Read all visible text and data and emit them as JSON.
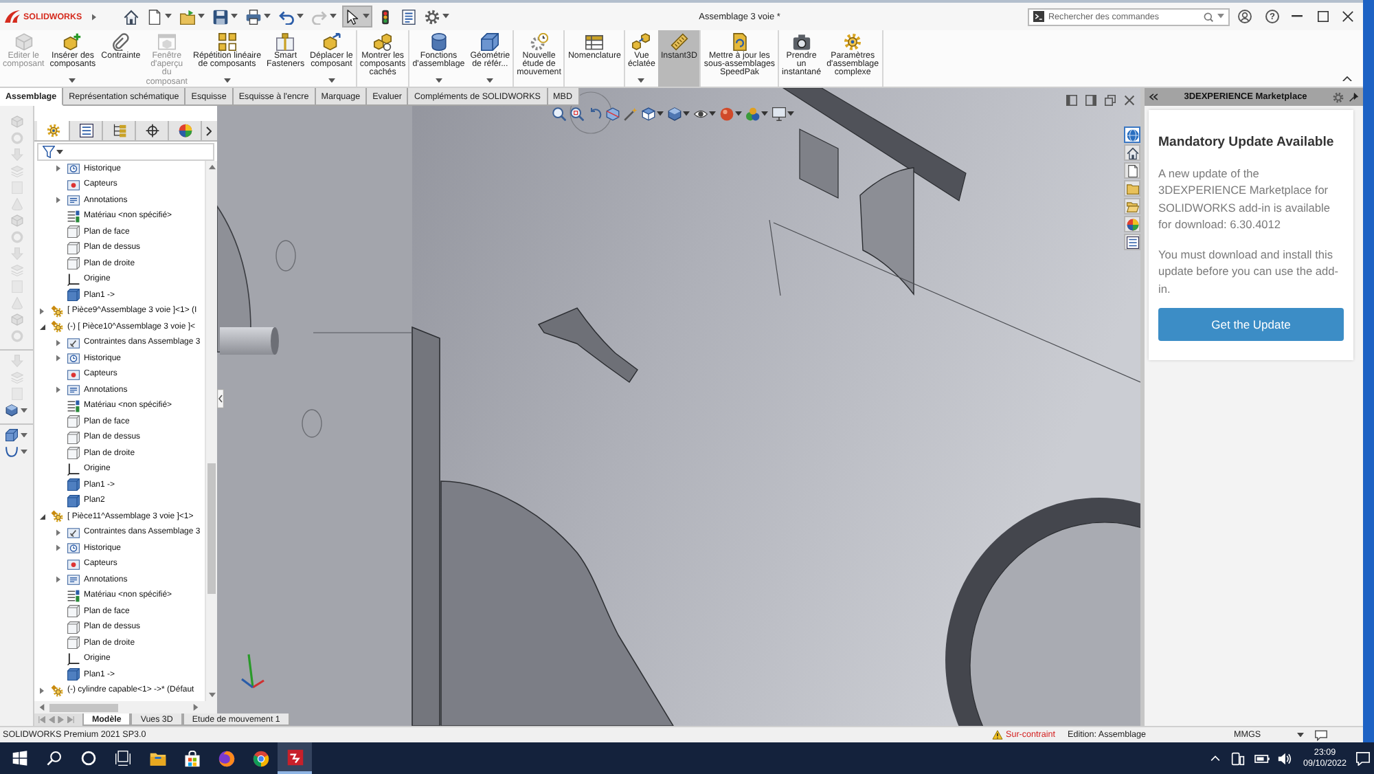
{
  "window": {
    "logo": "SOLIDWORKS",
    "title": "Assemblage 3 voie *",
    "search": {
      "placeholder": "Rechercher des commandes"
    },
    "help": "?"
  },
  "quick_access": [
    {
      "on": false,
      "disabled": false,
      "dropdown": false
    },
    {
      "on": false,
      "disabled": false,
      "dropdown": true
    },
    {
      "on": false,
      "disabled": false,
      "dropdown": true
    },
    {
      "on": false,
      "disabled": false,
      "dropdown": true
    },
    {
      "on": false,
      "disabled": false,
      "dropdown": true
    },
    {
      "on": false,
      "disabled": false,
      "dropdown": true
    },
    {
      "on": false,
      "disabled": true,
      "dropdown": true
    },
    {
      "on": true,
      "disabled": false,
      "dropdown": true
    },
    {
      "on": false,
      "disabled": false,
      "dropdown": false
    },
    {
      "on": false,
      "disabled": false,
      "dropdown": false
    },
    {
      "on": false,
      "disabled": false,
      "dropdown": true
    }
  ],
  "ribbon": {
    "groups": [
      {
        "buttons": [
          {
            "label": "Editer le\ncomposant",
            "disabled": true,
            "selected": false,
            "dropdown": false
          },
          {
            "label": "Insérer des\ncomposants",
            "disabled": false,
            "selected": false,
            "dropdown": true
          },
          {
            "label": "Contrainte",
            "disabled": false,
            "selected": false,
            "dropdown": false
          },
          {
            "label": "Fenêtre\nd'aperçu\ndu\ncomposant",
            "disabled": true,
            "selected": false,
            "dropdown": false
          },
          {
            "label": "Répétition linéaire\nde composants",
            "disabled": false,
            "selected": false,
            "dropdown": true
          },
          {
            "label": "Smart\nFasteners",
            "disabled": false,
            "selected": false,
            "dropdown": false
          },
          {
            "label": "Déplacer le\ncomposant",
            "disabled": false,
            "selected": false,
            "dropdown": true
          }
        ]
      },
      {
        "buttons": [
          {
            "label": "Montrer les\ncomposants\ncachés",
            "disabled": false,
            "selected": false,
            "dropdown": false
          }
        ]
      },
      {
        "buttons": [
          {
            "label": "Fonctions\nd'assemblage",
            "disabled": false,
            "selected": false,
            "dropdown": true
          },
          {
            "label": "Géométrie\nde référ...",
            "disabled": false,
            "selected": false,
            "dropdown": true
          }
        ]
      },
      {
        "buttons": [
          {
            "label": "Nouvelle\nétude de\nmouvement",
            "disabled": false,
            "selected": false,
            "dropdown": false
          }
        ]
      },
      {
        "buttons": [
          {
            "label": "Nomenclature",
            "disabled": false,
            "selected": false,
            "dropdown": false
          }
        ]
      },
      {
        "buttons": [
          {
            "label": "Vue\néclatée",
            "disabled": false,
            "selected": false,
            "dropdown": true
          },
          {
            "label": "Instant3D",
            "disabled": false,
            "selected": true,
            "dropdown": false
          }
        ]
      },
      {
        "buttons": [
          {
            "label": "Mettre à jour les\nsous-assemblages\nSpeedPak",
            "disabled": false,
            "selected": false,
            "dropdown": false
          }
        ]
      },
      {
        "buttons": [
          {
            "label": "Prendre\nun\ninstantané",
            "disabled": false,
            "selected": false,
            "dropdown": false
          },
          {
            "label": "Paramètres\nd'assemblage\ncomplexe",
            "disabled": false,
            "selected": false,
            "dropdown": false
          }
        ]
      }
    ]
  },
  "command_tabs": [
    {
      "label": "Assemblage",
      "selected": true
    },
    {
      "label": "Représentation schématique",
      "selected": false
    },
    {
      "label": "Esquisse",
      "selected": false
    },
    {
      "label": "Esquisse à l'encre",
      "selected": false
    },
    {
      "label": "Marquage",
      "selected": false
    },
    {
      "label": "Evaluer",
      "selected": false
    },
    {
      "label": "Compléments de SOLIDWORKS",
      "selected": false
    },
    {
      "label": "MBD",
      "selected": false
    }
  ],
  "left_toolbar": {
    "groups": [
      {
        "tools": [
          {
            "disabled": true,
            "dropdown": false
          },
          {
            "disabled": true,
            "dropdown": false
          },
          {
            "disabled": true,
            "dropdown": false
          },
          {
            "disabled": true,
            "dropdown": false
          },
          {
            "disabled": true,
            "dropdown": false
          },
          {
            "disabled": true,
            "dropdown": false
          },
          {
            "disabled": true,
            "dropdown": false
          },
          {
            "disabled": true,
            "dropdown": false
          },
          {
            "disabled": true,
            "dropdown": false
          },
          {
            "disabled": true,
            "dropdown": false
          },
          {
            "disabled": true,
            "dropdown": false
          },
          {
            "disabled": true,
            "dropdown": false
          },
          {
            "disabled": true,
            "dropdown": false
          },
          {
            "disabled": true,
            "dropdown": false
          }
        ]
      },
      {
        "tools": [
          {
            "disabled": true,
            "dropdown": false
          },
          {
            "disabled": true,
            "dropdown": false
          },
          {
            "disabled": true,
            "dropdown": false
          },
          {
            "disabled": false,
            "dropdown": true
          }
        ]
      },
      {
        "tools": [
          {
            "disabled": false,
            "dropdown": true
          },
          {
            "disabled": false,
            "dropdown": true
          }
        ]
      }
    ]
  },
  "feature_tree": {
    "panel_tabs": [
      {
        "selected": true
      },
      {
        "selected": false
      },
      {
        "selected": false
      },
      {
        "selected": false
      },
      {
        "selected": false
      }
    ],
    "items": [
      {
        "children": [
          {
            "label": "Historique",
            "kind": "history",
            "expanded": false
          },
          {
            "label": "Capteurs",
            "kind": "sensors"
          },
          {
            "label": "Annotations",
            "kind": "annotations",
            "expanded": false
          },
          {
            "label": "Matériau <non spécifié>",
            "kind": "material"
          },
          {
            "label": "Plan de face",
            "kind": "plane"
          },
          {
            "label": "Plan de dessus",
            "kind": "plane"
          },
          {
            "label": "Plan de droite",
            "kind": "plane"
          },
          {
            "label": "Origine",
            "kind": "origin"
          },
          {
            "label": "Plan1 ->",
            "kind": "sketch_plane"
          }
        ]
      },
      {
        "label": "[ Pièce9^Assemblage 3 voie ]<1> (I",
        "kind": "part",
        "expanded": false
      },
      {
        "label": "(-) [ Pièce10^Assemblage 3 voie ]<",
        "kind": "part",
        "expanded": true,
        "children": [
          {
            "label": "Contraintes dans Assemblage 3",
            "kind": "mates",
            "expanded": false
          },
          {
            "label": "Historique",
            "kind": "history",
            "expanded": false
          },
          {
            "label": "Capteurs",
            "kind": "sensors"
          },
          {
            "label": "Annotations",
            "kind": "annotations",
            "expanded": false
          },
          {
            "label": "Matériau <non spécifié>",
            "kind": "material"
          },
          {
            "label": "Plan de face",
            "kind": "plane"
          },
          {
            "label": "Plan de dessus",
            "kind": "plane"
          },
          {
            "label": "Plan de droite",
            "kind": "plane"
          },
          {
            "label": "Origine",
            "kind": "origin"
          },
          {
            "label": "Plan1 ->",
            "kind": "sketch_plane"
          },
          {
            "label": "Plan2",
            "kind": "sketch_plane"
          }
        ]
      },
      {
        "label": "[ Pièce11^Assemblage 3 voie ]<1>",
        "kind": "part",
        "expanded": true,
        "children": [
          {
            "label": "Contraintes dans Assemblage 3",
            "kind": "mates",
            "expanded": false
          },
          {
            "label": "Historique",
            "kind": "history",
            "expanded": false
          },
          {
            "label": "Capteurs",
            "kind": "sensors"
          },
          {
            "label": "Annotations",
            "kind": "annotations",
            "expanded": false
          },
          {
            "label": "Matériau <non spécifié>",
            "kind": "material"
          },
          {
            "label": "Plan de face",
            "kind": "plane"
          },
          {
            "label": "Plan de dessus",
            "kind": "plane"
          },
          {
            "label": "Plan de droite",
            "kind": "plane"
          },
          {
            "label": "Origine",
            "kind": "origin"
          },
          {
            "label": "Plan1 ->",
            "kind": "sketch_plane"
          }
        ]
      },
      {
        "label": "(-) cylindre capable<1> ->* (Défaut",
        "kind": "part",
        "expanded": false
      }
    ]
  },
  "tree_tabs": [
    {
      "label": "Modèle",
      "selected": true
    },
    {
      "label": "Vues 3D",
      "selected": false
    },
    {
      "label": "Etude de mouvement 1",
      "selected": false
    }
  ],
  "task_pane": {
    "title": "3DEXPERIENCE Marketplace",
    "tabs": [
      {
        "selected": true
      },
      {
        "selected": false
      },
      {
        "selected": false
      },
      {
        "selected": false
      },
      {
        "selected": false
      },
      {
        "selected": false
      },
      {
        "selected": false
      }
    ],
    "heading": "Mandatory Update Available",
    "paragraphs": [
      "A new update of the 3DEXPERIENCE Marketplace for SOLIDWORKS add-in is available for download: 6.30.4012",
      "You must download and install this update before you can use the add-in."
    ],
    "button": "Get the Update"
  },
  "status_bar": {
    "product": "SOLIDWORKS Premium 2021 SP3.0",
    "warning": "Sur-contraint",
    "mode": "Edition: Assemblage",
    "units": "MMGS"
  },
  "taskbar": {
    "apps": [
      {
        "active": false
      },
      {
        "active": false
      },
      {
        "active": false
      },
      {
        "active": false
      },
      {
        "active": true
      }
    ],
    "time": "23:09",
    "date": "09/10/2022"
  }
}
